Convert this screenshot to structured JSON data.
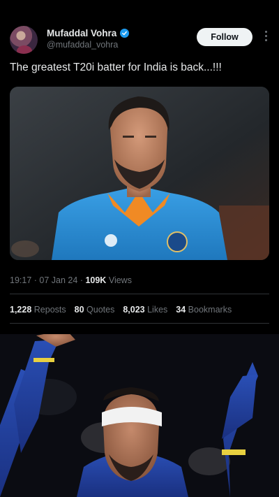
{
  "author": {
    "display_name": "Mufaddal Vohra",
    "handle": "@mufaddal_vohra",
    "verified_color": "#1d9bf0"
  },
  "follow_label": "Follow",
  "tweet_text": "The greatest T20i batter for India is back...!!!",
  "meta": {
    "time": "19:17",
    "date": "07 Jan 24",
    "views_count": "109K",
    "views_label": "Views"
  },
  "stats": {
    "reposts_count": "1,228",
    "reposts_label": "Reposts",
    "quotes_count": "80",
    "quotes_label": "Quotes",
    "likes_count": "8,023",
    "likes_label": "Likes",
    "bookmarks_count": "34",
    "bookmarks_label": "Bookmarks"
  },
  "colors": {
    "background": "#000000",
    "text_primary": "#e7e9ea",
    "text_secondary": "#71767b",
    "jersey_blue": "#2b8fd6"
  }
}
